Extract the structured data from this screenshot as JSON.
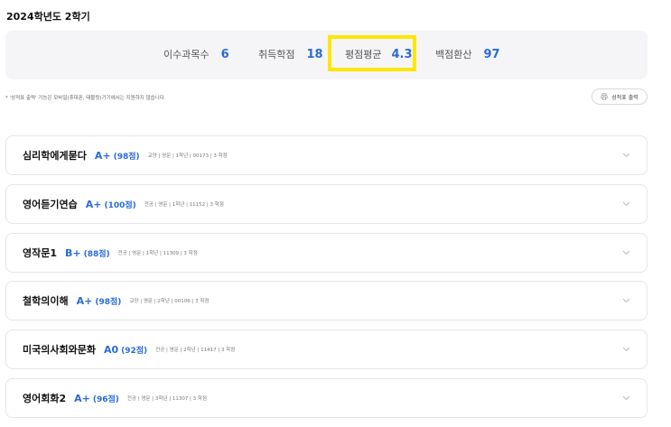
{
  "semester": {
    "title": "2024학년도 2학기"
  },
  "summary": {
    "credits_count_label": "이수과목수",
    "credits_count_value": "6",
    "earned_credits_label": "취득학점",
    "earned_credits_value": "18",
    "gpa_label": "평점평균",
    "gpa_value": "4.3",
    "percentile_label": "백점환산",
    "percentile_value": "97"
  },
  "colors": {
    "accent": "#2a6cd8",
    "highlight": "#ffe600",
    "summary_bg": "#f5f5f7",
    "card_border": "#e6e6e9"
  },
  "notice": "* '성적표 출력' 기능은 모바일(휴대폰, 태블릿)기기에서는 지원하지 않습니다.",
  "print_button": {
    "label": "성적표 출력",
    "icon": "printer-icon"
  },
  "courses": [
    {
      "name": "심리학에게묻다",
      "grade": "A+",
      "score": "(98점)",
      "meta": "교양 | 영문 | 1학년 | 00173 | 3 학점"
    },
    {
      "name": "영어듣기연습",
      "grade": "A+",
      "score": "(100점)",
      "meta": "전공 | 영문 | 1학년 | 11152 | 3 학점"
    },
    {
      "name": "영작문1",
      "grade": "B+",
      "score": "(88점)",
      "meta": "전공 | 영문 | 1학년 | 11309 | 3 학점"
    },
    {
      "name": "철학의이해",
      "grade": "A+",
      "score": "(98점)",
      "meta": "교양 | 영문 | 2학년 | 00106 | 3 학점"
    },
    {
      "name": "미국의사회와문화",
      "grade": "A0",
      "score": "(92점)",
      "meta": "전공 | 영문 | 2학년 | 11417 | 3 학점"
    },
    {
      "name": "영어회화2",
      "grade": "A+",
      "score": "(96점)",
      "meta": "전공 | 영문 | 3학년 | 11307 | 3 학점"
    }
  ]
}
